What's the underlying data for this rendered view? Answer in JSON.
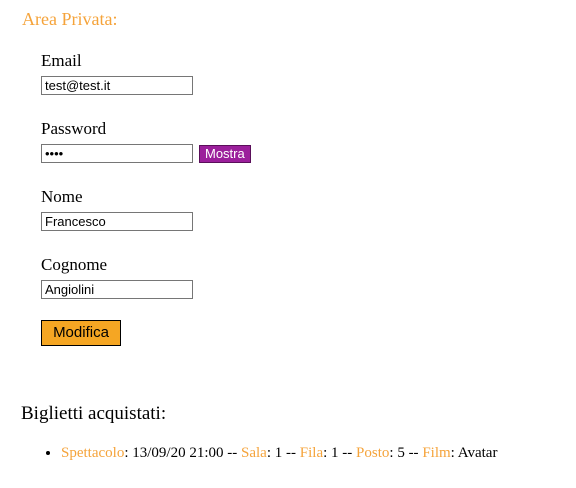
{
  "page": {
    "title": "Area Privata:",
    "accent_color": "#f5a33a",
    "button_color": "#f5a623",
    "show_button_color": "#9b1f9b"
  },
  "form": {
    "email": {
      "label": "Email",
      "value": "test@test.it"
    },
    "password": {
      "label": "Password",
      "value": "test",
      "show_label": "Mostra"
    },
    "nome": {
      "label": "Nome",
      "value": "Francesco"
    },
    "cognome": {
      "label": "Cognome",
      "value": "Angiolini"
    },
    "submit_label": "Modifica"
  },
  "tickets": {
    "heading": "Biglietti acquistati:",
    "separator": " -- ",
    "items": [
      {
        "spettacolo_label": "Spettacolo",
        "spettacolo": "13/09/20 21:00",
        "sala_label": "Sala",
        "sala": "1",
        "fila_label": "Fila",
        "fila": "1",
        "posto_label": "Posto",
        "posto": "5",
        "film_label": "Film",
        "film": "Avatar"
      }
    ]
  }
}
